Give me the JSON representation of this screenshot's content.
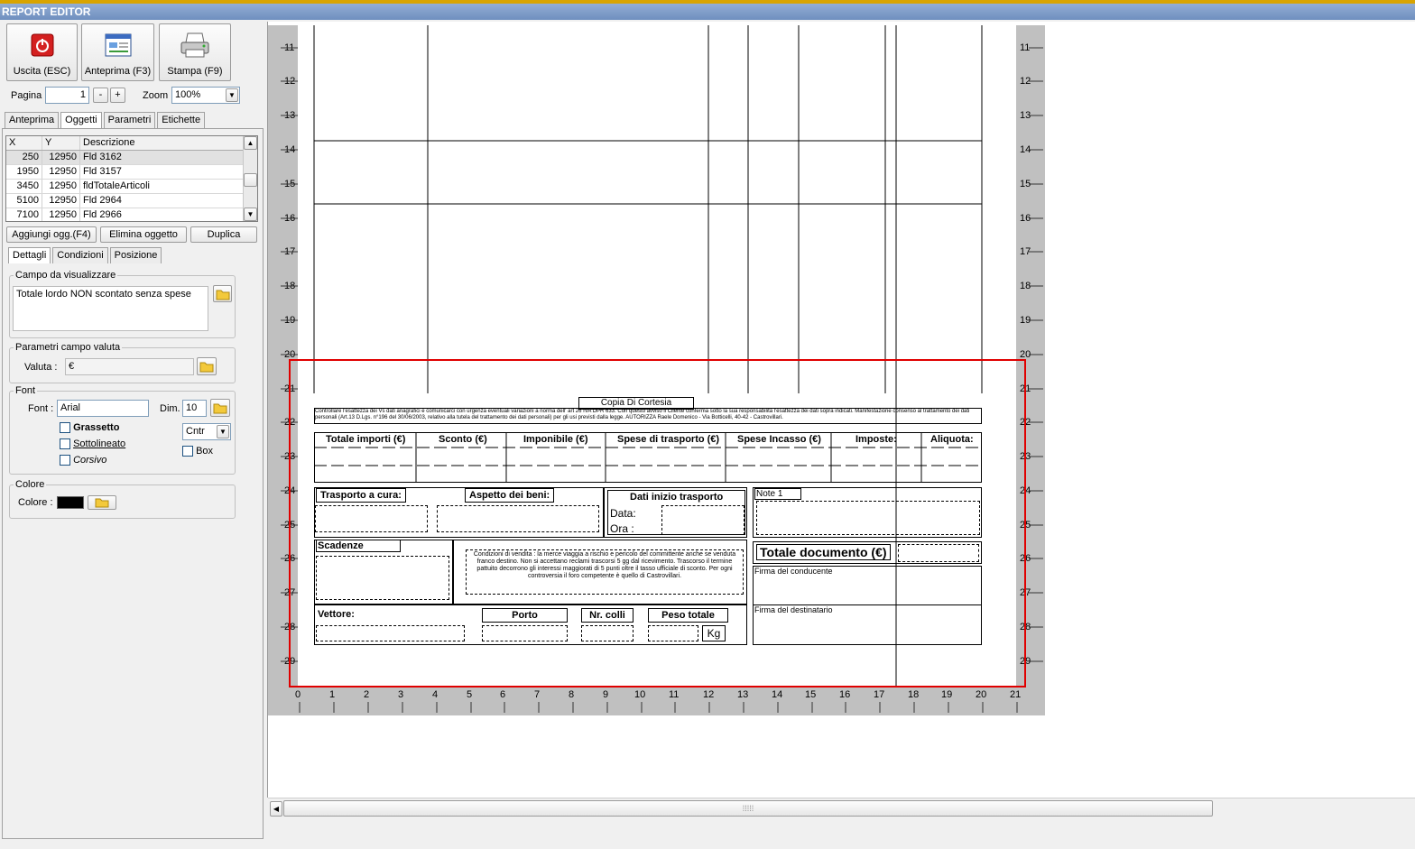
{
  "window": {
    "title": "REPORT EDITOR"
  },
  "toolbar": {
    "exit_label": "Uscita (ESC)",
    "preview_label": "Anteprima (F3)",
    "print_label": "Stampa (F9)",
    "page_label": "Pagina",
    "page_value": "1",
    "page_minus": "-",
    "page_plus": "+",
    "zoom_label": "Zoom",
    "zoom_value": "100%"
  },
  "tabs_top": [
    "Anteprima",
    "Oggetti",
    "Parametri",
    "Etichette"
  ],
  "objects_table": {
    "headers": [
      "X",
      "Y",
      "Descrizione"
    ],
    "rows": [
      [
        "250",
        "12950",
        "Fld 3162"
      ],
      [
        "1950",
        "12950",
        "Fld 3157"
      ],
      [
        "3450",
        "12950",
        "fldTotaleArticoli"
      ],
      [
        "5100",
        "12950",
        "Fld 2964"
      ],
      [
        "7100",
        "12950",
        "Fld 2966"
      ]
    ]
  },
  "object_buttons": {
    "add": "Aggiungi ogg.(F4)",
    "delete": "Elimina oggetto",
    "duplicate": "Duplica"
  },
  "tabs_detail": [
    "Dettagli",
    "Condizioni",
    "Posizione"
  ],
  "field_group": {
    "legend": "Campo da visualizzare",
    "value": "Totale lordo NON scontato senza spese"
  },
  "currency_group": {
    "legend": "Parametri campo valuta",
    "label": "Valuta :",
    "value": "€"
  },
  "font_group": {
    "legend": "Font",
    "font_label": "Font :",
    "font_value": "Arial",
    "dim_label": "Dim.",
    "dim_value": "10",
    "bold": "Grassetto",
    "underline": "Sottolineato",
    "italic": "Corsivo",
    "align_value": "Cntr",
    "box_label": "Box"
  },
  "color_group": {
    "legend": "Colore",
    "label": "Colore :",
    "value": "#000000"
  },
  "ruler": {
    "vertical": [
      "11",
      "12",
      "13",
      "14",
      "15",
      "16",
      "17",
      "18",
      "19",
      "20",
      "21",
      "22",
      "23",
      "24",
      "25",
      "26",
      "27",
      "28",
      "29"
    ],
    "horizontal": [
      "0",
      "1",
      "2",
      "3",
      "4",
      "5",
      "6",
      "7",
      "8",
      "9",
      "10",
      "11",
      "12",
      "13",
      "14",
      "15",
      "16",
      "17",
      "18",
      "19",
      "20",
      "21"
    ]
  },
  "document": {
    "copy_label": "Copia Di Cortesia",
    "notice": "Controllare l'esattezza dei Vs dati anagrafici e comunicarci con urgenza eventuali variazioni a norma dell' art 26 IVA DPR 633. Con questo avviso il Cliente conferma sotto la sua responsabilità l'esattezza dei dati sopra indicati. Manifestazione consenso al trattamento dei dati personali (Art.13 D.Lgs. n°196 del 30/06/2003, relativo alla tutela del trattamento dei dati personali) per gli usi previsti dalla legge. AUTORIZZA Raele Domenico - Via Botticelli, 40-42 - Castrovillari.",
    "totals_headers": [
      "Totale importi (€)",
      "Sconto (€)",
      "Imponibile (€)",
      "Spese di trasporto (€)",
      "Spese Incasso (€)",
      "Imposte:",
      "Aliquota:"
    ],
    "transport_label": "Trasporto a cura:",
    "aspect_label": "Aspetto dei beni:",
    "transport_start_label": "Dati inizio trasporto",
    "date_label": "Data:",
    "time_label": "Ora :",
    "notes_label": "Note 1",
    "due_label": "Scadenze",
    "conditions": "Condizioni di vendita : la merce viaggia a rischio e pericolo del committente anche se venduta franco destino. Non si accettano reclami trascorsi 5 gg dal ricevimento. Trascorso il termine pattuito decorrono gli interessi maggiorati di 5 punti oltre il tasso ufficiale di sconto. Per ogni controversia il foro competente è quello di Castrovillari.",
    "total_doc_label": "Totale documento (€)",
    "driver_sign": "Firma del conducente",
    "recipient_sign": "Firma del destinatario",
    "carrier_label": "Vettore:",
    "port_label": "Porto",
    "packages_label": "Nr. colli",
    "weight_label": "Peso totale",
    "kg_label": "Kg"
  },
  "colors": {
    "selection_frame": "#e00000",
    "accent": "#6f8fbf"
  }
}
